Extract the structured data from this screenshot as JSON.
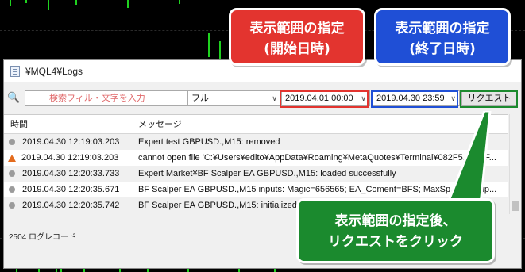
{
  "window": {
    "title": "¥MQL4¥Logs"
  },
  "toolbar": {
    "search_placeholder": "検索フィル・文字を入力",
    "filter_value": "フル",
    "date_from": "2019.04.01 00:00",
    "date_to": "2019.04.30 23:59",
    "request_label": "リクエスト"
  },
  "table": {
    "col_time": "時間",
    "col_message": "メッセージ",
    "rows": [
      {
        "type": "info",
        "time": "2019.04.30 12:19:03.203",
        "message": "Expert test GBPUSD.,M15: removed"
      },
      {
        "type": "warning",
        "time": "2019.04.30 12:19:03.203",
        "message": "cannot open file 'C:¥Users¥edito¥AppData¥Roaming¥MetaQuotes¥Terminal¥082F5...881F..."
      },
      {
        "type": "info",
        "time": "2019.04.30 12:20:33.733",
        "message": "Expert Market¥BF Scalper EA GBPUSD.,M15: loaded successfully"
      },
      {
        "type": "info",
        "time": "2019.04.30 12:20:35.671",
        "message": "BF Scalper EA GBPUSD.,M15 inputs: Magic=656565; EA_Coment=BFS; MaxSp...3.0; Slip..."
      },
      {
        "type": "info",
        "time": "2019.04.30 12:20:35.742",
        "message": "BF Scalper EA GBPUSD.,M15: initialized"
      }
    ]
  },
  "status": {
    "text": "2504 ログレコード"
  },
  "callouts": {
    "start_line1": "表示範囲の指定",
    "start_line2": "(開始日時)",
    "end_line1": "表示範囲の指定",
    "end_line2": "(終了日時)",
    "request_line1": "表示範囲の指定後、",
    "request_line2": "リクエストをクリック"
  },
  "colors": {
    "red": "#e3342f",
    "blue": "#1f4fd6",
    "green": "#1b8a2e",
    "chart_bar": "#1fd21f"
  }
}
